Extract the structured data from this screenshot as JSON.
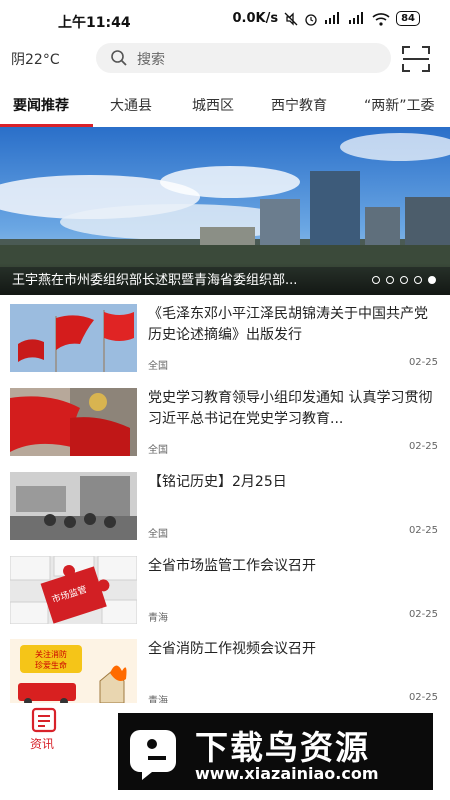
{
  "status_bar": {
    "time": "上午11:44",
    "speed": "0.0K/s",
    "battery": "84"
  },
  "header": {
    "weather": "阴22°C",
    "search_placeholder": "搜索",
    "scan_icon": "scan-icon"
  },
  "tabs": [
    {
      "label": "要闻推荐",
      "active": true
    },
    {
      "label": "大通县",
      "active": false
    },
    {
      "label": "城西区",
      "active": false
    },
    {
      "label": "西宁教育",
      "active": false
    },
    {
      "label": "“两新”工委",
      "active": false
    }
  ],
  "banner": {
    "caption": "王宇燕在市州委组织部长述职暨青海省委组织部...",
    "page_count": 5,
    "active_page": 5
  },
  "news": [
    {
      "title": "《毛泽东邓小平江泽民胡锦涛关于中国共产党历史论述摘编》出版发行",
      "source": "全国",
      "date": "02-25"
    },
    {
      "title": "党史学习教育领导小组印发通知 认真学习贯彻习近平总书记在党史学习教育...",
      "source": "全国",
      "date": "02-25"
    },
    {
      "title": "【铭记历史】2月25日",
      "source": "全国",
      "date": "02-25"
    },
    {
      "title": "全省市场监管工作会议召开",
      "source": "青海",
      "date": "02-25"
    },
    {
      "title": "全省消防工作视频会议召开",
      "source": "青海",
      "date": "02-25"
    }
  ],
  "thumb_text": {
    "puzzle": "市场监管",
    "fire": "关注消防\n珍爱生命"
  },
  "bottom_nav": {
    "label": "资讯",
    "accent": "#d8222a"
  },
  "watermark": {
    "title": "下载鸟资源",
    "url": "www.xiazainiao.com"
  }
}
